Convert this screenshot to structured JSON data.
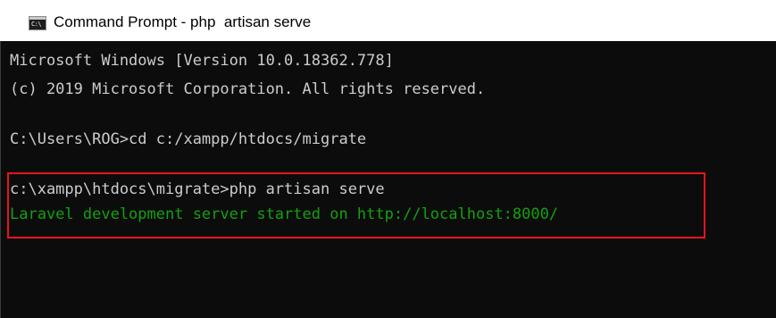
{
  "window": {
    "title": "Command Prompt - php  artisan serve",
    "app_icon_text": "C:\\",
    "app_icon": "command-prompt-icon"
  },
  "console": {
    "lines": [
      "Microsoft Windows [Version 10.0.18362.778]",
      "(c) 2019 Microsoft Corporation. All rights reserved.",
      "",
      "C:\\Users\\ROG>cd c:/xampp/htdocs/migrate",
      "",
      "c:\\xampp\\htdocs\\migrate>php artisan serve",
      "Laravel development server started on http://localhost:8000/"
    ],
    "text_color": "#cccccc",
    "success_color": "#13a10e",
    "background_color": "#0c0c0c",
    "highlight_color": "#e8141e"
  }
}
